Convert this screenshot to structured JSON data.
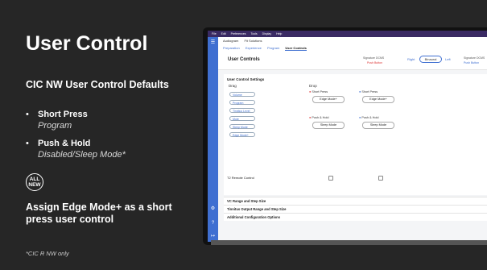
{
  "slide": {
    "title": "User Control",
    "subtitle": "CIC NW User Control Defaults",
    "bullets": [
      {
        "label": "Short Press",
        "value": "Program"
      },
      {
        "label": "Push & Hold",
        "value": "Disabled/Sleep Mode*"
      }
    ],
    "badge_line1": "ALL",
    "badge_line2": "NEW",
    "assign_text": "Assign Edge Mode+ as a short press user control",
    "footnote": "*CIC R NW only"
  },
  "app": {
    "menu": [
      "File",
      "Edit",
      "Preferences",
      "Tools",
      "Display",
      "Help"
    ],
    "top_tabs": [
      "Audiogram",
      "Fit Solutions"
    ],
    "nav": [
      "Preparation",
      "Experience",
      "Program",
      "User Controls"
    ],
    "header_title": "User Controls",
    "program_label": "Signature DCMS",
    "program_status": "Push Button",
    "right_label": "Right",
    "binaural_label": "Binaural",
    "left_label": "Left",
    "program_label2": "Signature DCMS",
    "program_status2": "Push Button",
    "panel_title": "User Control Settings",
    "drag_label": "Drag",
    "drop_label": "Drop",
    "drag_items": [
      "Volume",
      "Program",
      "Tinnitus Level",
      "Mute",
      "Sleep Mode",
      "Edge Mode+"
    ],
    "right_short_label": "Short Press",
    "right_short_value": "Edge Mode+",
    "left_short_label": "Short Press",
    "left_short_value": "Edge Mode+",
    "right_hold_label": "Push & Hold",
    "right_hold_value": "Sleep Mode",
    "left_hold_label": "Push & Hold",
    "left_hold_value": "Sleep Mode",
    "t2_label": "T2 Remote Control",
    "sections": [
      "VC Range and Step Size",
      "Tinnitus Output Range and Step Size",
      "Additional Configuration Options"
    ]
  },
  "colors": {
    "accent": "#3f6fd1",
    "red": "#d33333",
    "slide_bg": "#262626"
  }
}
